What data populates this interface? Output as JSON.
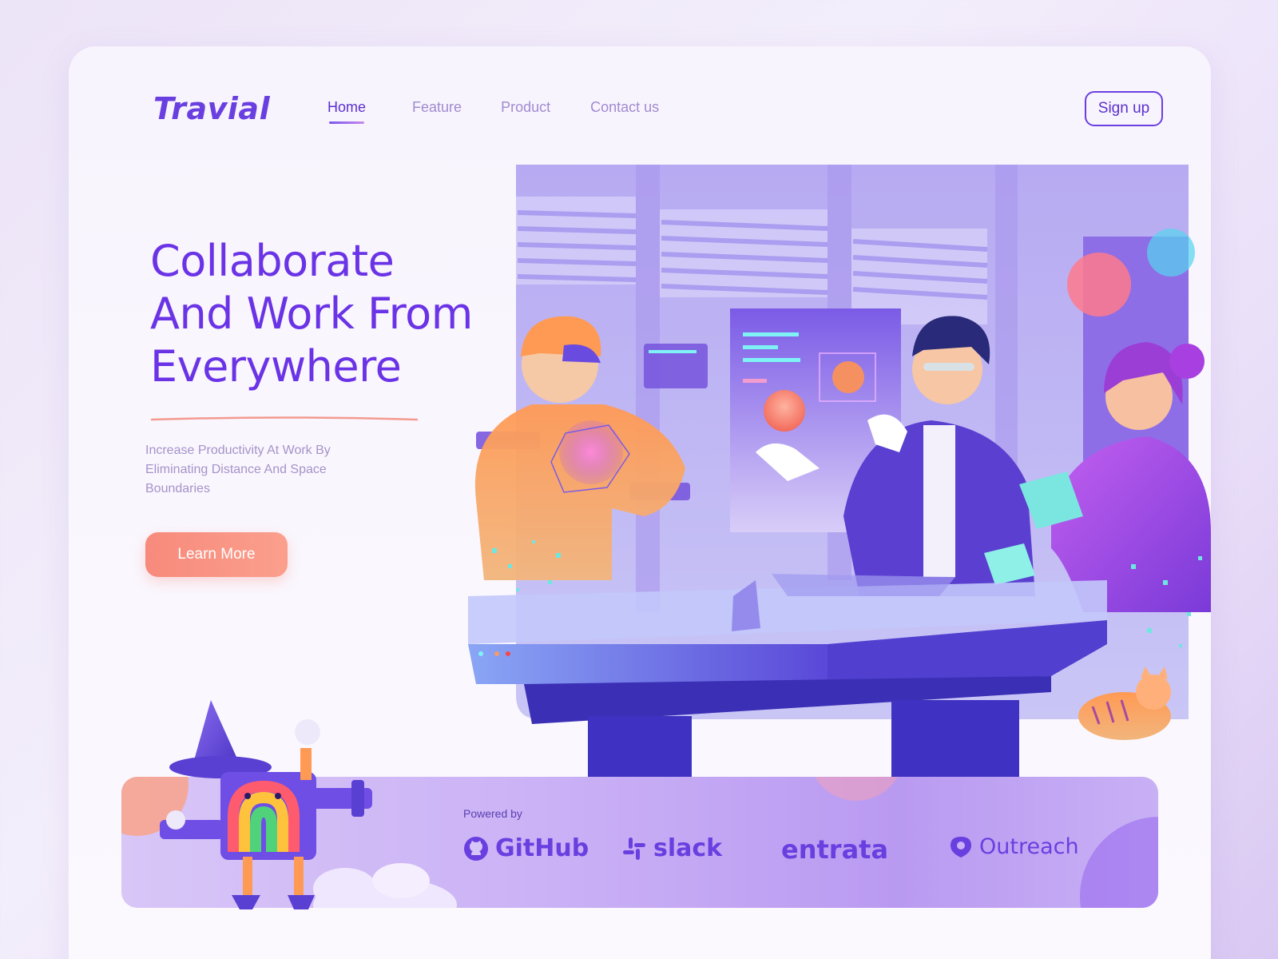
{
  "brand": {
    "logo_text": "Travial"
  },
  "nav": {
    "items": [
      {
        "label": "Home",
        "active": true
      },
      {
        "label": "Feature",
        "active": false
      },
      {
        "label": "Product",
        "active": false
      },
      {
        "label": "Contact us",
        "active": false
      }
    ],
    "signup_label": "Sign up"
  },
  "hero": {
    "title_lines": [
      "Collaborate",
      "And Work From",
      "Everywhere"
    ],
    "subtitle_lines": [
      "Increase Productivity At Work By",
      "Eliminating Distance  And Space",
      "Boundaries"
    ],
    "cta_label": "Learn More"
  },
  "powered": {
    "label": "Powered by",
    "partners": [
      {
        "name": "GitHub",
        "icon": "github-icon"
      },
      {
        "name": "slack",
        "icon": "slack-icon"
      },
      {
        "name": "entrata",
        "icon": ""
      },
      {
        "name": "Outreach",
        "icon": "outreach-icon"
      }
    ]
  },
  "colors": {
    "brand": "#6a3fe0",
    "accent": "#f78a7c",
    "text_muted": "#a593c9"
  }
}
